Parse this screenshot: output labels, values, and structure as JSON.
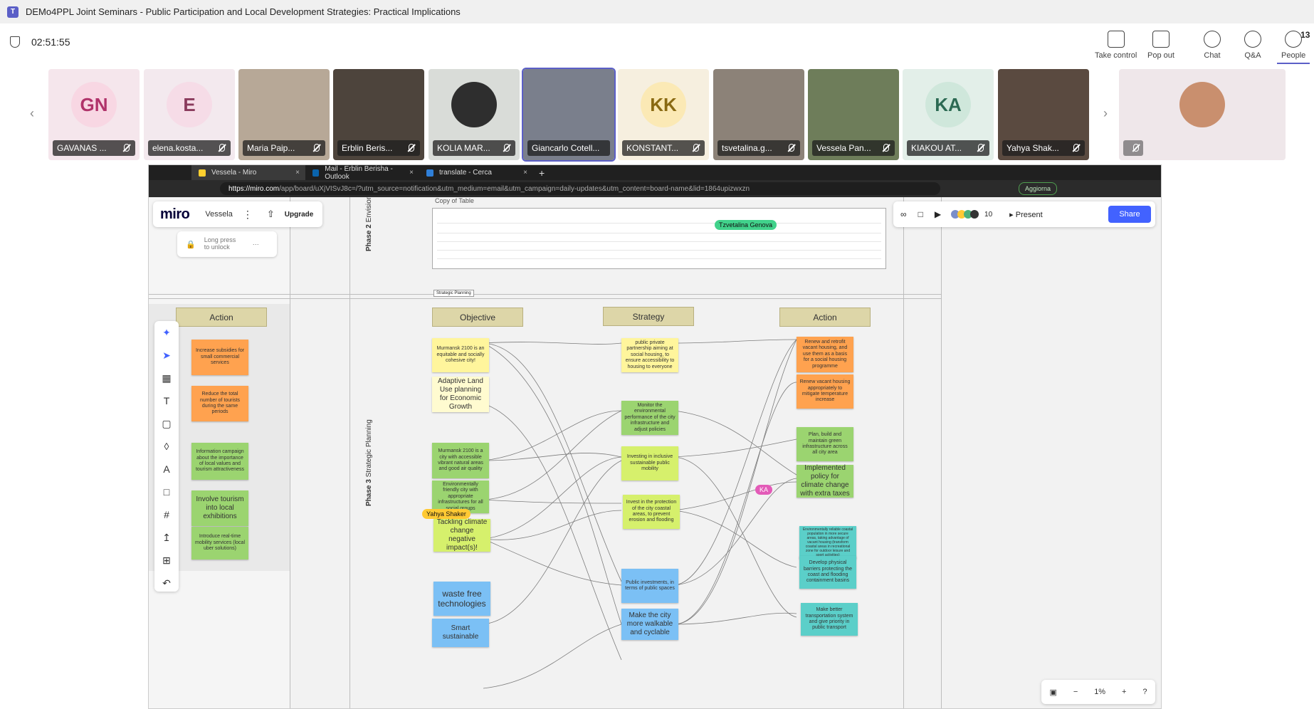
{
  "window": {
    "title": "DEMo4PPL Joint Seminars - Public Participation and Local Development Strategies: Practical Implications"
  },
  "call": {
    "timer": "02:51:55",
    "controls": [
      {
        "label": "Take control",
        "icon": "take-control-icon"
      },
      {
        "label": "Pop out",
        "icon": "pop-out-icon"
      },
      {
        "label": "Chat",
        "icon": "chat-icon"
      },
      {
        "label": "Q&A",
        "icon": "qna-icon"
      },
      {
        "label": "People",
        "icon": "people-icon",
        "count": "13"
      }
    ]
  },
  "participants": [
    {
      "name": "GAVANAS ...",
      "initials": "GN",
      "bg": "#f5e6ec",
      "color": "#b0336a",
      "avbg": "#f8d7e3"
    },
    {
      "name": "elena.kosta...",
      "initials": "E",
      "bg": "#f3e9ee",
      "color": "#8a3a5c",
      "avbg": "#f6dce7"
    },
    {
      "name": "Maria Paip...",
      "initials": "",
      "bg": "#b7a897"
    },
    {
      "name": "Erblin Beris...",
      "initials": "",
      "bg": "#4d443c"
    },
    {
      "name": "KOLIA MAR...",
      "initials": "",
      "bg": "#d9dcd8",
      "avbg": "#2e2e2e"
    },
    {
      "name": "Giancarlo Cotell...",
      "initials": "",
      "bg": "#7a7f8c"
    },
    {
      "name": "KONSTANT...",
      "initials": "KK",
      "bg": "#f6efdf",
      "color": "#8a6a12",
      "avbg": "#fbe9b5"
    },
    {
      "name": "tsvetalina.g...",
      "initials": "",
      "bg": "#8c8278"
    },
    {
      "name": "Vessela Pan...",
      "initials": "",
      "bg": "#6e7d5a"
    },
    {
      "name": "KIAKOU AT...",
      "initials": "KA",
      "bg": "#e3efe9",
      "color": "#2c6a53",
      "avbg": "#cfe7db"
    },
    {
      "name": "Yahya Shak...",
      "initials": "",
      "bg": "#5a4a40"
    },
    {
      "name": "",
      "initials": "",
      "bg": "#efe7ea",
      "avbg": "#c98f6e"
    }
  ],
  "browser": {
    "tabs": [
      {
        "title": "Vessela - Miro",
        "color": "#ffd02f"
      },
      {
        "title": "Mail - Erblin Berisha - Outlook",
        "color": "#0a64ad"
      },
      {
        "title": "translate - Cerca",
        "color": "#2f7fd8"
      }
    ],
    "url_host": "https://miro.com",
    "url_path": "/app/board/uXjVISvJ8c=/?utm_source=notification&utm_medium=email&utm_campaign=daily-updates&utm_content=board-name&lid=1864upizwxzn",
    "update_label": "Aggiorna"
  },
  "miro": {
    "logo": "miro",
    "board_name": "Vessela",
    "upgrade": "Upgrade",
    "lock_text": "Long press to unlock",
    "table_title": "Copy of Table",
    "present": "Present",
    "share": "Share",
    "collab_count": "10",
    "zoom": "1%",
    "frame_label": "Strategic Planning",
    "phase2": "Phase 2",
    "phase2_sub": "Envisioning",
    "phase3": "Phase 3",
    "phase3_sub": "Strategic Planning",
    "headers": {
      "action_left": "Action",
      "objective": "Objective",
      "strategy": "Strategy",
      "action_right": "Action"
    },
    "cursors": {
      "tzvetalina": "Tzvetalina Genova",
      "yahya": "Yahya Shaker",
      "ka": "KA"
    },
    "left_actions": [
      "Increase subsidies for small commercial services",
      "Reduce the total number of tourists during the same periods",
      "Information campaign about the importance of local values and tourism attractiveness",
      "Involve tourism into local exhibitions",
      "Introduce real-time mobility services (local uber solutions)"
    ],
    "objectives": [
      "Murmansk 2100 is an equitable and socially cohesive city!",
      "Adaptive Land Use planning for Economic Growth",
      "Murmansk 2100 is a city with accessible vibrant natural areas and good air quality",
      "Environmentally friendly city with appropriate infrastructures for all social groups",
      "Tackling climate change negative impact(s)!",
      "waste free technologies",
      "Smart sustainable"
    ],
    "strategies": [
      "public private partnership aiming at social housing, to ensure accessibility to housing to everyone",
      "Monitor the environmental performance of the city infrastructure and adjust policies",
      "Investing in inclusive sustainable public mobility",
      "Invest in the protection of the city coastal areas, to prevent erosion and flooding",
      "Public investments, in terms of public spaces",
      "Make the city more walkable and cyclable"
    ],
    "right_actions": [
      "Renew and retrofit vacant housing, and use them as a basis for a social housing programme",
      "Renew vacant housing appropriately to mitigate temperature increase",
      "Plan, build and maintain green infrastructure across all city area",
      "Implemented policy for climate change with extra taxes",
      "Environmentally reliable coastal population in more secure areas, taking advantage of vacant housing (transform coastal areas in recreational zone for outdoor leisure and sport activities)",
      "Develop physical barriers protecting the coast and flooding containment basins",
      "Make better transportation system and give priority in public transport"
    ]
  }
}
